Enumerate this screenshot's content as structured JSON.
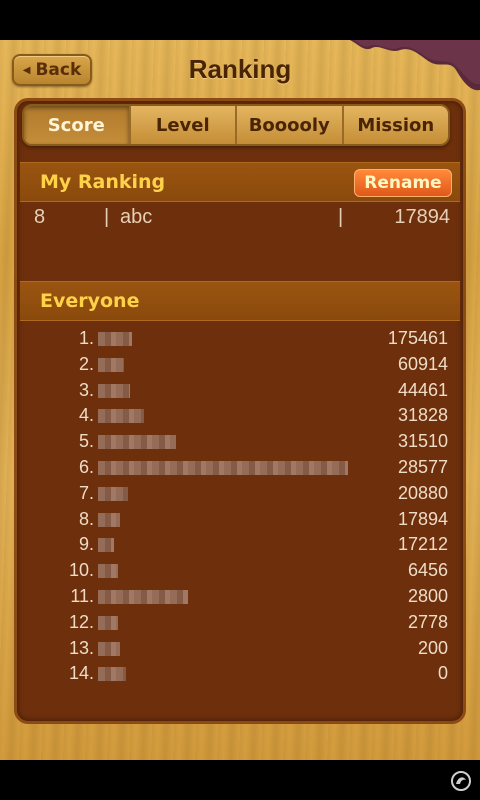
{
  "header": {
    "back_label": "Back",
    "title": "Ranking"
  },
  "tabs": [
    {
      "label": "Score",
      "active": true
    },
    {
      "label": "Level",
      "active": false
    },
    {
      "label": "Booooly",
      "active": false
    },
    {
      "label": "Mission",
      "active": false
    }
  ],
  "my_ranking": {
    "header": "My Ranking",
    "rename_label": "Rename",
    "rank": "8",
    "separator": "|",
    "name": "abc",
    "score": "17894"
  },
  "everyone": {
    "header": "Everyone",
    "rows": [
      {
        "rank": "1.",
        "score": "175461"
      },
      {
        "rank": "2.",
        "score": "60914"
      },
      {
        "rank": "3.",
        "score": "44461"
      },
      {
        "rank": "4.",
        "score": "31828"
      },
      {
        "rank": "5.",
        "score": "31510"
      },
      {
        "rank": "6.",
        "score": "28577"
      },
      {
        "rank": "7.",
        "score": "20880"
      },
      {
        "rank": "8.",
        "score": "17894"
      },
      {
        "rank": "9.",
        "score": "17212"
      },
      {
        "rank": "10.",
        "score": "6456"
      },
      {
        "rank": "11.",
        "score": "2800"
      },
      {
        "rank": "12.",
        "score": "2778"
      },
      {
        "rank": "13.",
        "score": "200"
      },
      {
        "rank": "14.",
        "score": "0"
      }
    ]
  },
  "colors": {
    "panel": "#6e2f0c",
    "section_header": "#9a5410",
    "header_text": "#ffd24a",
    "rename_button": "#e0581a",
    "wood": "#e2b156"
  }
}
